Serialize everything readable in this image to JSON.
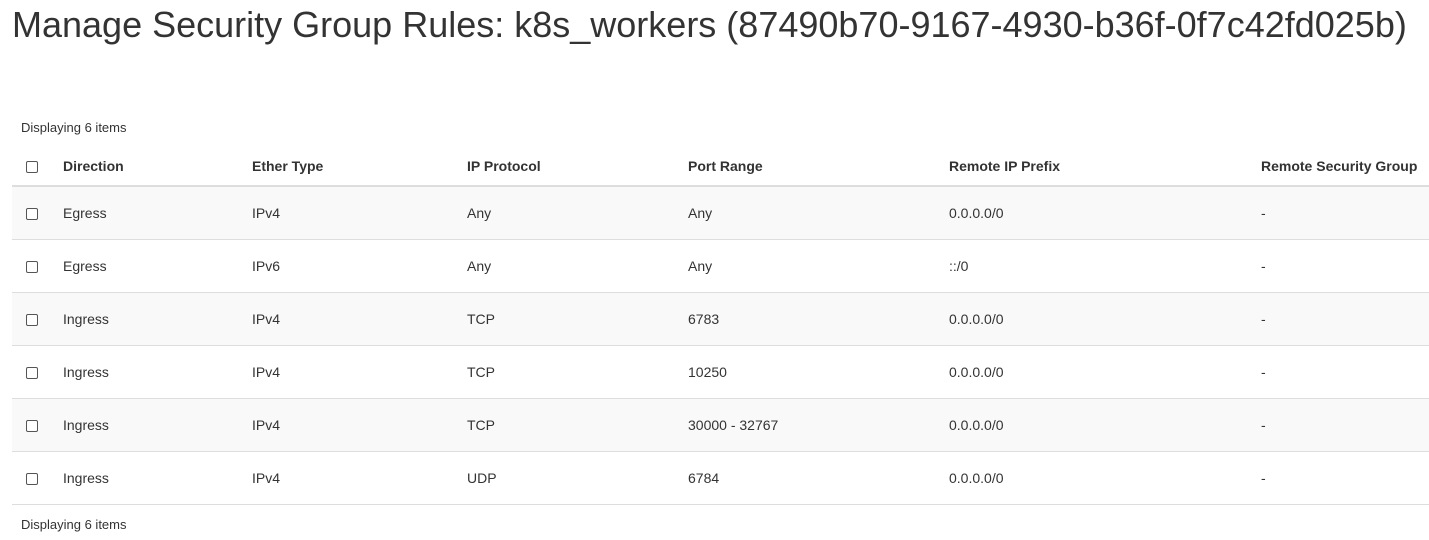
{
  "page": {
    "title": "Manage Security Group Rules: k8s_workers (87490b70-9167-4930-b36f-0f7c42fd025b)"
  },
  "table": {
    "count_label": "Displaying 6 items",
    "headers": {
      "direction": "Direction",
      "ether_type": "Ether Type",
      "ip_protocol": "IP Protocol",
      "port_range": "Port Range",
      "remote_ip_prefix": "Remote IP Prefix",
      "remote_security_group": "Remote Security Group"
    },
    "rows": [
      {
        "direction": "Egress",
        "ether_type": "IPv4",
        "ip_protocol": "Any",
        "port_range": "Any",
        "remote_ip_prefix": "0.0.0.0/0",
        "remote_security_group": "-"
      },
      {
        "direction": "Egress",
        "ether_type": "IPv6",
        "ip_protocol": "Any",
        "port_range": "Any",
        "remote_ip_prefix": "::/0",
        "remote_security_group": "-"
      },
      {
        "direction": "Ingress",
        "ether_type": "IPv4",
        "ip_protocol": "TCP",
        "port_range": "6783",
        "remote_ip_prefix": "0.0.0.0/0",
        "remote_security_group": "-"
      },
      {
        "direction": "Ingress",
        "ether_type": "IPv4",
        "ip_protocol": "TCP",
        "port_range": "10250",
        "remote_ip_prefix": "0.0.0.0/0",
        "remote_security_group": "-"
      },
      {
        "direction": "Ingress",
        "ether_type": "IPv4",
        "ip_protocol": "TCP",
        "port_range": "30000 - 32767",
        "remote_ip_prefix": "0.0.0.0/0",
        "remote_security_group": "-"
      },
      {
        "direction": "Ingress",
        "ether_type": "IPv4",
        "ip_protocol": "UDP",
        "port_range": "6784",
        "remote_ip_prefix": "0.0.0.0/0",
        "remote_security_group": "-"
      }
    ]
  }
}
